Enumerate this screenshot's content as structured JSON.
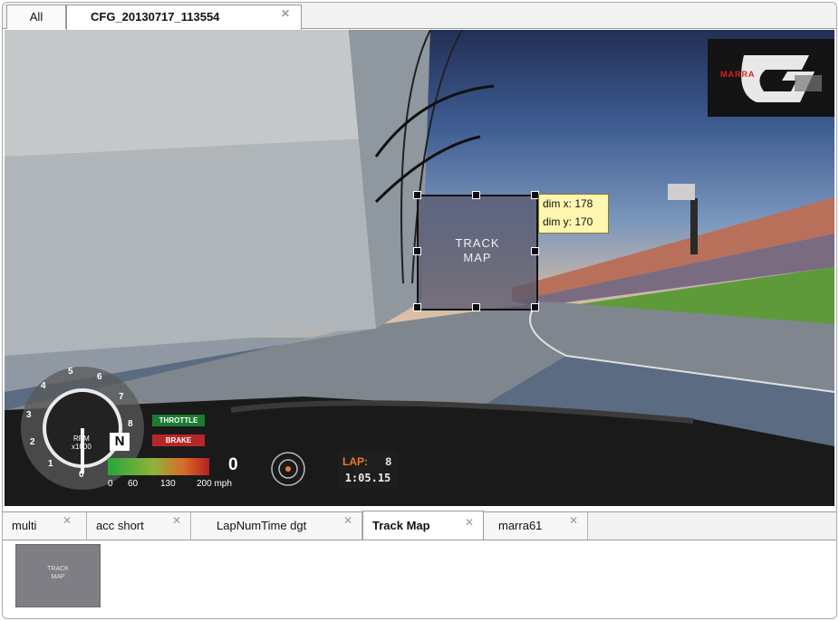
{
  "top_tabs": {
    "all_label": "All",
    "file_label": "CFG_20130717_113554",
    "close_glyph": "✕"
  },
  "overlay": {
    "selection_label_line1": "TRACK",
    "selection_label_line2": "MAP",
    "dim_x": "dim x: 178",
    "dim_y": "dim y: 170"
  },
  "logo": {
    "text": "MARRA",
    "accent_color": "#e02020"
  },
  "hud": {
    "rpm_label_line1": "RPM",
    "rpm_label_line2": "x1000",
    "gauge_ticks": [
      "0",
      "1",
      "2",
      "3",
      "4",
      "5",
      "6",
      "7",
      "8"
    ],
    "gear": "N",
    "throttle_label": "THROTTLE",
    "brake_label": "BRAKE",
    "speed_value": "0",
    "speed_scale": [
      "0",
      "60",
      "130",
      "200 mph"
    ],
    "lap_label": "LAP:",
    "lap_number": "8",
    "lap_time": "1:05.15"
  },
  "bottom_tabs": [
    {
      "label": "multi",
      "active": false
    },
    {
      "label": "acc short",
      "active": false
    },
    {
      "label": "LapNumTime dgt",
      "active": false
    },
    {
      "label": "Track Map",
      "active": true
    },
    {
      "label": "marra61",
      "active": false
    }
  ],
  "thumbnail": {
    "line1": "TRACK",
    "line2": "MAP"
  }
}
